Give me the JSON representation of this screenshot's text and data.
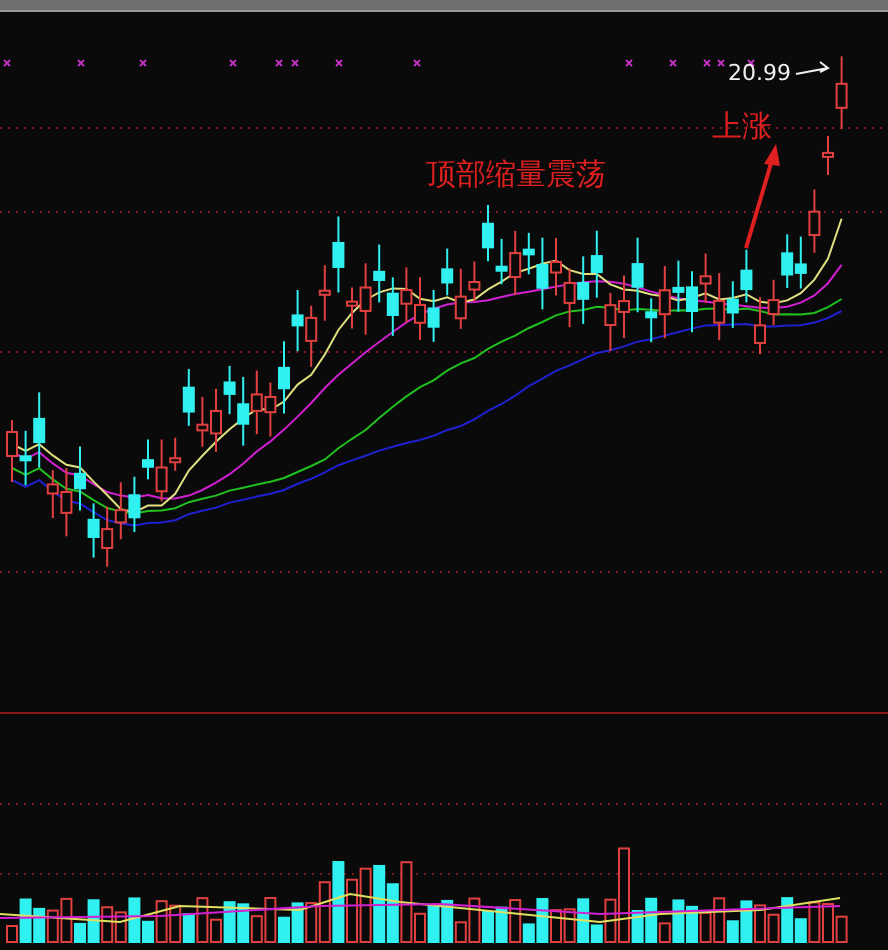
{
  "chart": {
    "price_label": "20.99",
    "annotations": [
      {
        "kind": "caption",
        "text": "顶部缩量震荡"
      },
      {
        "kind": "arrow_caption",
        "text": "上涨"
      }
    ]
  }
}
